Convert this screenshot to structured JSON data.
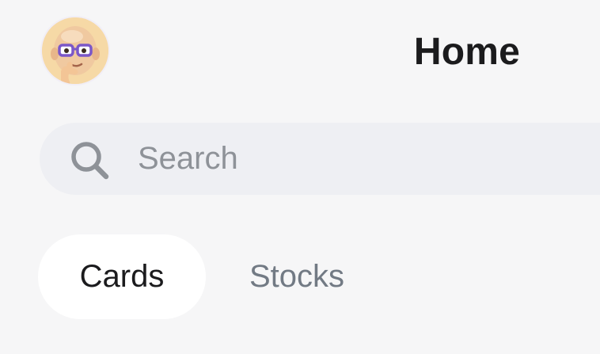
{
  "header": {
    "title": "Home",
    "avatar_icon": "memoji-avatar-icon"
  },
  "search": {
    "placeholder": "Search",
    "value": "",
    "icon": "search-icon"
  },
  "tabs": [
    {
      "label": "Cards",
      "active": true
    },
    {
      "label": "Stocks",
      "active": false
    }
  ],
  "colors": {
    "background": "#f6f6f7",
    "search_background": "#eeeff3",
    "active_tab_background": "#ffffff",
    "text_primary": "#1b1b1d",
    "text_secondary": "#727a84",
    "placeholder": "#8e9298",
    "avatar_background": "#f6d9a6",
    "glasses": "#7b57c8"
  }
}
